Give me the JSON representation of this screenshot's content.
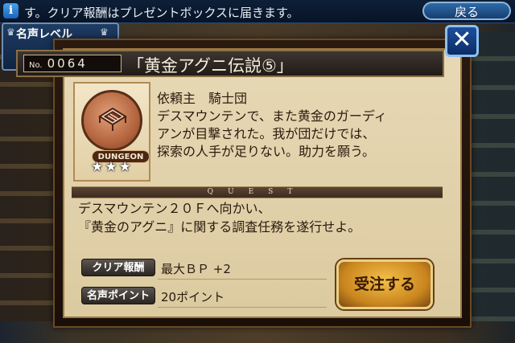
{
  "topbar": {
    "info_icon": "i",
    "ticker": "す。クリア報酬はプレゼントボックスに届きます。",
    "back_label": "戻る"
  },
  "fame": {
    "label": "名声レベル",
    "crown_icon": "crown-icon"
  },
  "quest": {
    "number_prefix": "No.",
    "number": "0064",
    "title": "「黄金アグニ伝説⑤」",
    "close_icon": "close-icon",
    "emblem": {
      "label": "DUNGEON",
      "stars": "★★★",
      "star_count": 3
    },
    "client_lines": [
      "依頼主　騎士団",
      "デスマウンテンで、また黄金のガーディ",
      "アンが目撃された。我が団だけでは、",
      "探索の人手が足りない。助力を願う。"
    ],
    "strip_label": "QUEST",
    "description_lines": [
      "デスマウンテン２０Ｆへ向かい、",
      "『黄金のアグニ』に関する調査任務を遂行せよ。"
    ],
    "rewards": [
      {
        "label": "クリア報酬",
        "value": "最大ＢＰ +2"
      },
      {
        "label": "名声ポイント",
        "value": "20ポイント"
      }
    ],
    "accept_label": "受注する"
  },
  "colors": {
    "topbar": "#0d1f38",
    "parchment": "#e7d9b6",
    "accent_blue": "#1d4f9c",
    "accept_gold": "#f3c14a"
  }
}
